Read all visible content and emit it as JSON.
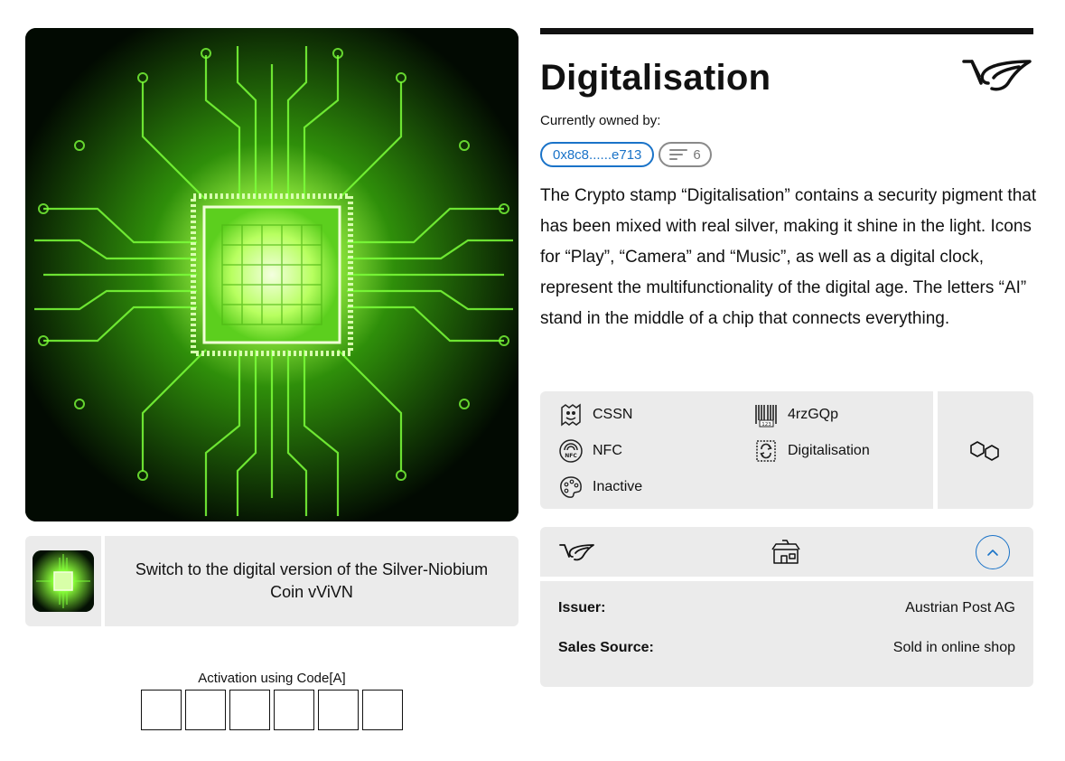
{
  "stamp": {
    "title": "Digitalisation",
    "owned_label": "Currently owned by:",
    "owner_address": "0x8c8......e713",
    "owner_count": "6",
    "description": "The Crypto stamp “Digitalisation” contains a security pigment that has been mixed with real silver, making it shine in the light. Icons for “Play”, “Camera” and “Music”, as well as a digital clock, represent the multifunctionality of the digital age. The letters “AI” stand in the middle of a chip that connects everything."
  },
  "switch_card": {
    "text": "Switch to the digital version of the Silver-Niobium Coin vViVN"
  },
  "activation": {
    "label": "Activation using Code[A]",
    "boxes": 6
  },
  "attributes": [
    {
      "icon": "cssn-icon",
      "label": "CSSN"
    },
    {
      "icon": "barcode-icon",
      "label": "4rzGQp"
    },
    {
      "icon": "nfc-icon",
      "label": "NFC"
    },
    {
      "icon": "stamp-refresh-icon",
      "label": "Digitalisation"
    },
    {
      "icon": "palette-icon",
      "label": "Inactive"
    }
  ],
  "chain_icon": "polygon-chain-icon",
  "issuer": {
    "rows": [
      {
        "key": "Issuer:",
        "value": "Austrian Post AG"
      },
      {
        "key": "Sales Source:",
        "value": "Sold in online shop"
      }
    ]
  },
  "colors": {
    "accent": "#1a73c8",
    "card_bg": "#ebebeb",
    "chip_green": "#7cff3a"
  }
}
